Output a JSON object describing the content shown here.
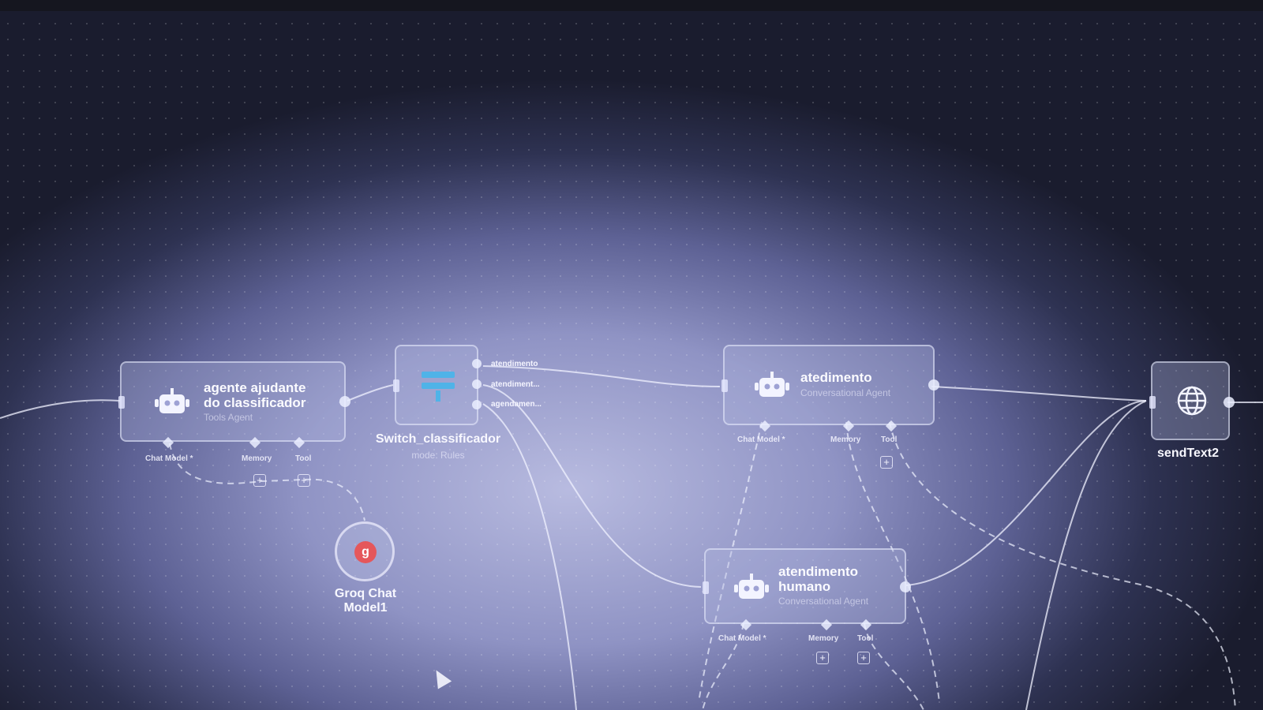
{
  "nodes": {
    "agent_helper": {
      "title_line1": "agente ajudante",
      "title_line2": "do classificador",
      "subtitle": "Tools Agent",
      "ports": {
        "chat_model": "Chat Model *",
        "memory": "Memory",
        "tool": "Tool"
      },
      "icon": "robot-icon"
    },
    "switch": {
      "title": "Switch_classificador",
      "subtitle": "mode: Rules",
      "outputs": [
        "atendimento",
        "atendiment...",
        "agendamen..."
      ],
      "icon": "switch-icon"
    },
    "groq": {
      "title_line1": "Groq Chat",
      "title_line2": "Model1",
      "icon": "groq-icon"
    },
    "atedimento": {
      "title": "atedimento",
      "subtitle": "Conversational Agent",
      "ports": {
        "chat_model": "Chat Model *",
        "memory": "Memory",
        "tool": "Tool"
      },
      "icon": "robot-icon"
    },
    "atendimento_humano": {
      "title_line1": "atendimento",
      "title_line2": "humano",
      "subtitle": "Conversational Agent",
      "ports": {
        "chat_model": "Chat Model *",
        "memory": "Memory",
        "tool": "Tool"
      },
      "icon": "robot-icon"
    },
    "sendtext": {
      "title": "sendText2",
      "icon": "globe-icon"
    }
  },
  "plus_symbol": "+",
  "colors": {
    "background": "#8f93c4",
    "node_border": "#ebeeff",
    "groq_accent": "#e5575b",
    "switch_accent": "#4fb3e8"
  }
}
